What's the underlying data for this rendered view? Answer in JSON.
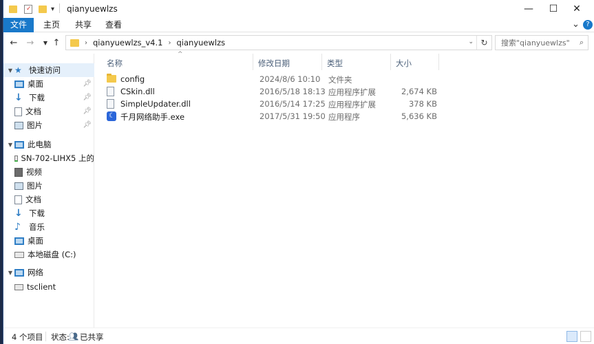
{
  "titlebar": {
    "title": "qianyuewlzs",
    "qa_dropdown": "▾",
    "minimize": "—",
    "maximize": "☐",
    "close": "✕"
  },
  "ribbon": {
    "tabs": [
      "文件",
      "主页",
      "共享",
      "查看"
    ],
    "expand": "⌄",
    "help": "?"
  },
  "address": {
    "crumbs": [
      "qianyuewlzs_v4.1",
      "qianyuewlzs"
    ],
    "separator": "›",
    "search_placeholder": "搜索\"qianyuewlzs\""
  },
  "nav": {
    "quick_access": "快速访问",
    "quick_items": [
      "桌面",
      "下载",
      "文档",
      "图片"
    ],
    "this_pc": "此电脑",
    "pc_items": [
      "SN-702-LIHX5 上的",
      "视频",
      "图片",
      "文档",
      "下载",
      "音乐",
      "桌面",
      "本地磁盘 (C:)"
    ],
    "network": "网络",
    "network_items": [
      "tsclient"
    ]
  },
  "columns": {
    "name": "名称",
    "date": "修改日期",
    "type": "类型",
    "size": "大小"
  },
  "files": [
    {
      "name": "config",
      "date": "2024/8/6 10:10",
      "type": "文件夹",
      "size": "",
      "icon": "folder-icon"
    },
    {
      "name": "CSkin.dll",
      "date": "2016/5/18 18:13",
      "type": "应用程序扩展",
      "size": "2,674 KB",
      "icon": "dll-file-icon"
    },
    {
      "name": "SimpleUpdater.dll",
      "date": "2016/5/14 17:25",
      "type": "应用程序扩展",
      "size": "378 KB",
      "icon": "dll-file-icon"
    },
    {
      "name": "千月网络助手.exe",
      "date": "2017/5/31 19:50",
      "type": "应用程序",
      "size": "5,636 KB",
      "icon": "app-moon-icon"
    }
  ],
  "status": {
    "count": "4 个项目",
    "state_label": "状态:",
    "state_value": "已共享"
  },
  "colors": {
    "accent": "#1979ca",
    "selected_bg": "#e5f0fb",
    "folder": "#f4c94c"
  }
}
